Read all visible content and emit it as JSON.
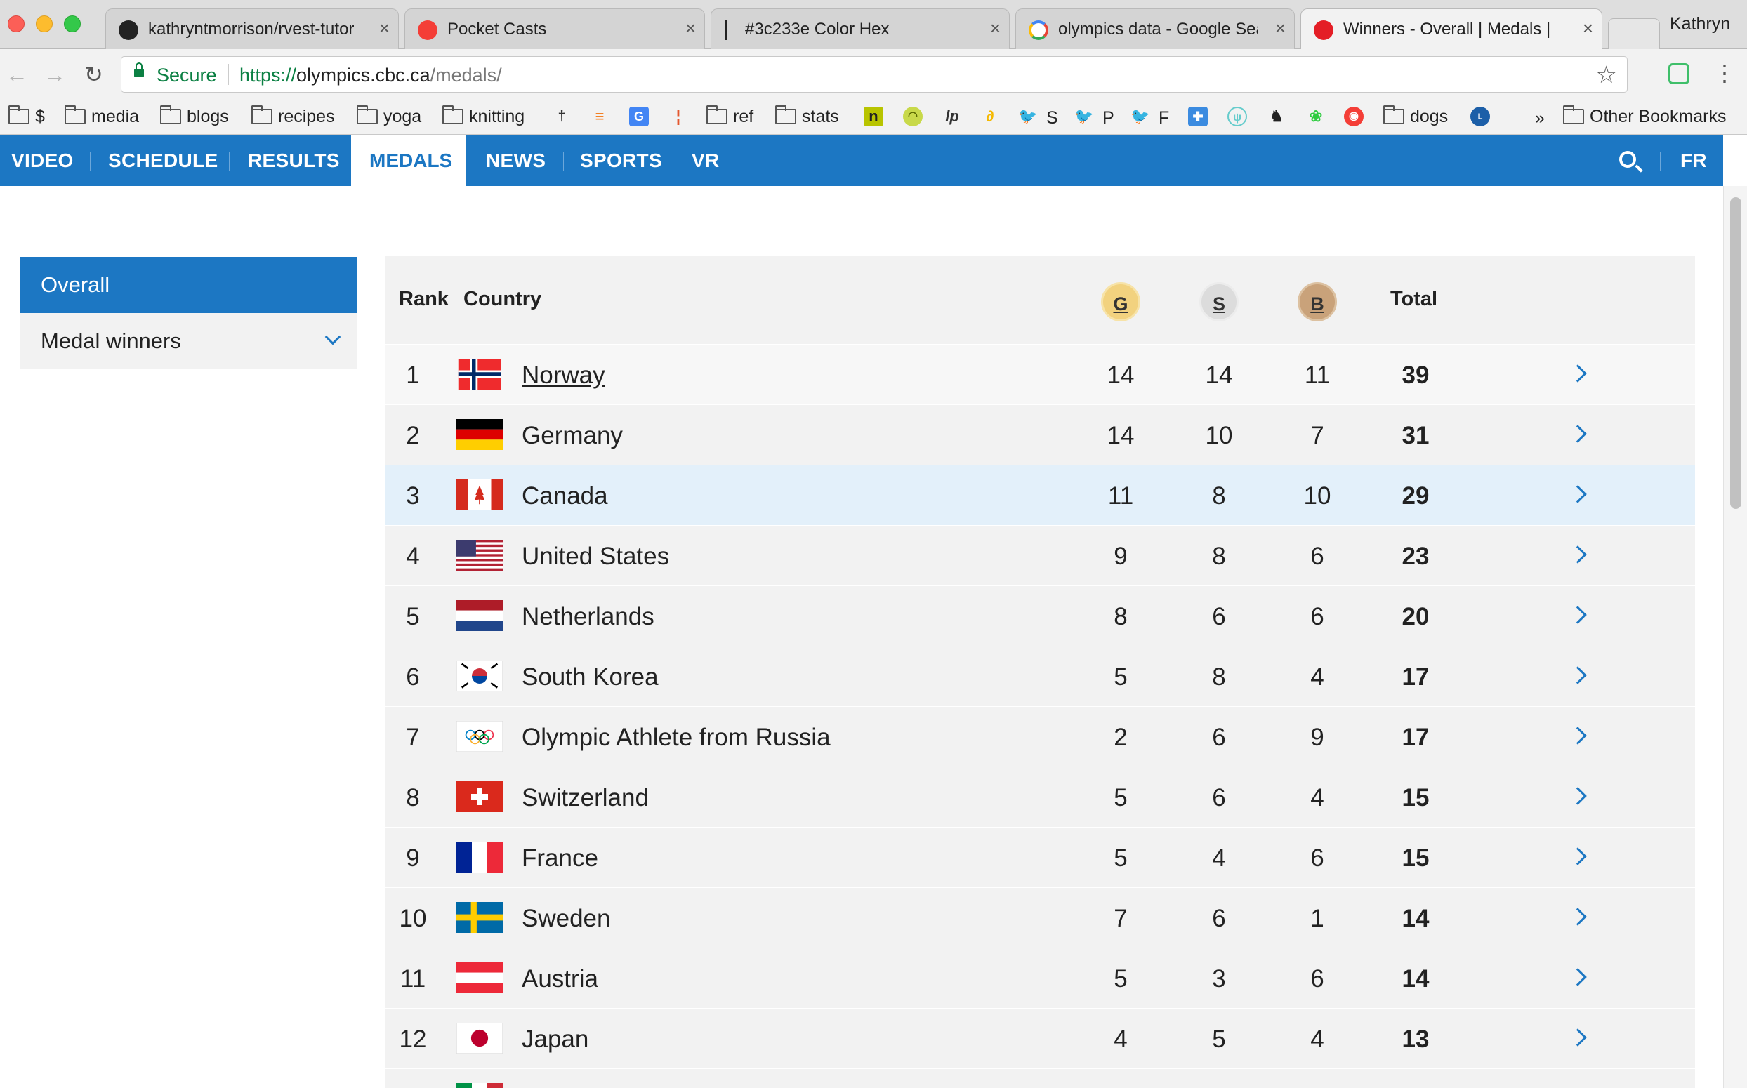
{
  "browser": {
    "tabs": [
      {
        "title": "kathryntmorrison/rvest-tutor",
        "icon": "github-icon"
      },
      {
        "title": "Pocket Casts",
        "icon": "pocket-casts-icon"
      },
      {
        "title": "#3c233e Color Hex",
        "icon": "pin-icon"
      },
      {
        "title": "olympics data - Google Sear",
        "icon": "google-icon"
      },
      {
        "title": "Winners - Overall | Medals |",
        "icon": "cbc-icon"
      }
    ],
    "profile_name": "Kathryn",
    "secure_label": "Secure",
    "url_scheme": "https://",
    "url_host": "olympics.cbc.ca",
    "url_path": "/medals/",
    "bookmarks": [
      {
        "label": "$",
        "type": "folder"
      },
      {
        "label": "media",
        "type": "folder"
      },
      {
        "label": "blogs",
        "type": "folder"
      },
      {
        "label": "recipes",
        "type": "folder"
      },
      {
        "label": "yoga",
        "type": "folder"
      },
      {
        "label": "knitting",
        "type": "folder"
      },
      {
        "label": "ref",
        "type": "folder"
      },
      {
        "label": "stats",
        "type": "folder"
      },
      {
        "label": "S",
        "type": "twitter"
      },
      {
        "label": "P",
        "type": "twitter"
      },
      {
        "label": "F",
        "type": "twitter"
      },
      {
        "label": "dogs",
        "type": "folder"
      },
      {
        "label": "Other Bookmarks",
        "type": "folder"
      }
    ],
    "bookmarks_overflow": "»"
  },
  "site_nav": {
    "items": [
      "VIDEO",
      "SCHEDULE",
      "RESULTS",
      "MEDALS",
      "NEWS",
      "SPORTS",
      "VR"
    ],
    "active": "MEDALS",
    "lang": "FR"
  },
  "sidebar": {
    "overall": "Overall",
    "medal_winners": "Medal winners"
  },
  "table": {
    "headers": {
      "rank": "Rank",
      "country": "Country",
      "gold": "G",
      "silver": "S",
      "bronze": "B",
      "total": "Total"
    },
    "rows": [
      {
        "rank": "1",
        "country": "Norway",
        "gold": "14",
        "silver": "14",
        "bronze": "11",
        "total": "39"
      },
      {
        "rank": "2",
        "country": "Germany",
        "gold": "14",
        "silver": "10",
        "bronze": "7",
        "total": "31"
      },
      {
        "rank": "3",
        "country": "Canada",
        "gold": "11",
        "silver": "8",
        "bronze": "10",
        "total": "29"
      },
      {
        "rank": "4",
        "country": "United States",
        "gold": "9",
        "silver": "8",
        "bronze": "6",
        "total": "23"
      },
      {
        "rank": "5",
        "country": "Netherlands",
        "gold": "8",
        "silver": "6",
        "bronze": "6",
        "total": "20"
      },
      {
        "rank": "6",
        "country": "South Korea",
        "gold": "5",
        "silver": "8",
        "bronze": "4",
        "total": "17"
      },
      {
        "rank": "7",
        "country": "Olympic Athlete from Russia",
        "gold": "2",
        "silver": "6",
        "bronze": "9",
        "total": "17"
      },
      {
        "rank": "8",
        "country": "Switzerland",
        "gold": "5",
        "silver": "6",
        "bronze": "4",
        "total": "15"
      },
      {
        "rank": "9",
        "country": "France",
        "gold": "5",
        "silver": "4",
        "bronze": "6",
        "total": "15"
      },
      {
        "rank": "10",
        "country": "Sweden",
        "gold": "7",
        "silver": "6",
        "bronze": "1",
        "total": "14"
      },
      {
        "rank": "11",
        "country": "Austria",
        "gold": "5",
        "silver": "3",
        "bronze": "6",
        "total": "14"
      },
      {
        "rank": "12",
        "country": "Japan",
        "gold": "4",
        "silver": "5",
        "bronze": "4",
        "total": "13"
      }
    ]
  },
  "colors": {
    "brand_blue": "#1c77c3",
    "highlight_row": "#e3f0fa",
    "gold": "#f2d27f",
    "silver": "#dcdcdc",
    "bronze": "#c9a27a"
  }
}
